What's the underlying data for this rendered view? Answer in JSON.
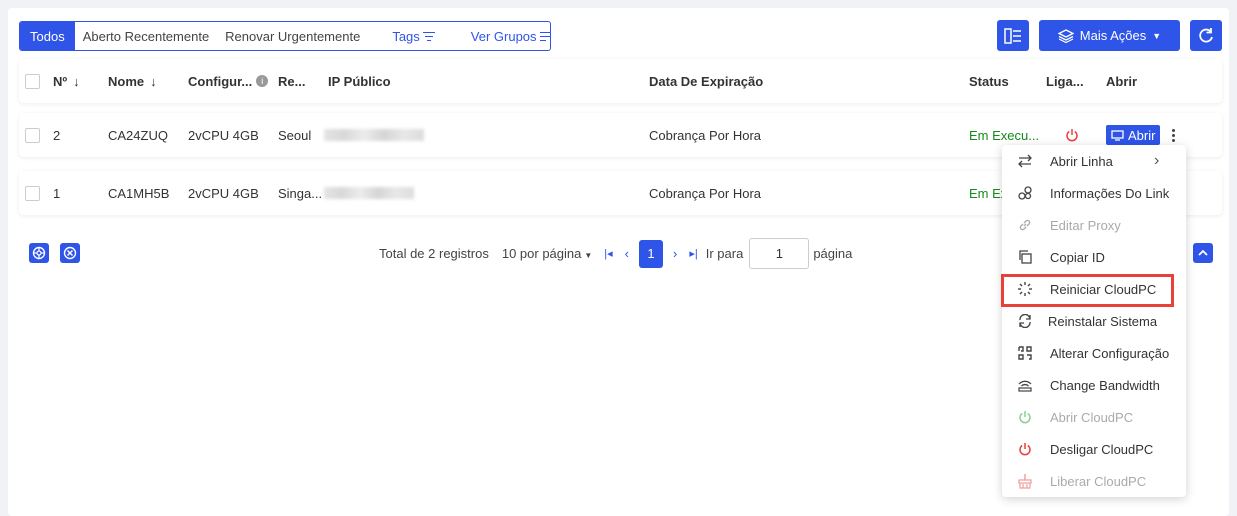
{
  "filters": {
    "tabs": [
      "Todos",
      "Aberto Recentemente",
      "Renovar Urgentemente"
    ],
    "tags_label": "Tags",
    "groups_label": "Ver Grupos"
  },
  "toolbar": {
    "more_actions_label": "Mais Ações"
  },
  "table": {
    "headers": {
      "no": "Nº",
      "name": "Nome",
      "config": "Configur...",
      "region": "Re...",
      "ip": "IP Público",
      "expiry": "Data De Expiração",
      "status": "Status",
      "link": "Liga...",
      "open": "Abrir"
    },
    "rows": [
      {
        "no": "2",
        "name": "CA24ZUQ",
        "config": "2vCPU 4GB",
        "region": "Seoul",
        "expiry": "Cobrança Por Hora",
        "status": "Em Execu...",
        "open_label": "Abrir"
      },
      {
        "no": "1",
        "name": "CA1MH5B",
        "config": "2vCPU 4GB",
        "region": "Singa...",
        "expiry": "Cobrança Por Hora",
        "status": "Em Exe"
      }
    ]
  },
  "pagination": {
    "total": "Total de 2 registros",
    "per_page": "10 por página",
    "current_page": "1",
    "goto_label": "Ir para",
    "goto_value": "1",
    "page_suffix": "página"
  },
  "menu": {
    "items": [
      {
        "label": "Abrir Linha",
        "icon": "swap-arrows-icon",
        "disabled": false
      },
      {
        "label": "Informações Do Link",
        "icon": "link-chain-icon",
        "disabled": false
      },
      {
        "label": "Editar Proxy",
        "icon": "link-icon",
        "disabled": true
      },
      {
        "label": "Copiar ID",
        "icon": "copy-icon",
        "disabled": false
      },
      {
        "label": "Reiniciar CloudPC",
        "icon": "loading-spinner-icon",
        "disabled": false
      },
      {
        "label": "Reinstalar Sistema",
        "icon": "refresh-icon",
        "disabled": false
      },
      {
        "label": "Alterar Configuração",
        "icon": "config-icon",
        "disabled": false
      },
      {
        "label": "Change Bandwidth",
        "icon": "bandwidth-icon",
        "disabled": false
      },
      {
        "label": "Abrir CloudPC",
        "icon": "power-green-icon",
        "disabled": true
      },
      {
        "label": "Desligar CloudPC",
        "icon": "power-red-icon",
        "disabled": false
      },
      {
        "label": "Liberar CloudPC",
        "icon": "broom-icon",
        "disabled": true
      }
    ]
  },
  "colors": {
    "accent": "#2e54e8",
    "running": "#138a1c",
    "power_off": "#e8413a",
    "highlight": "#e8413a"
  }
}
